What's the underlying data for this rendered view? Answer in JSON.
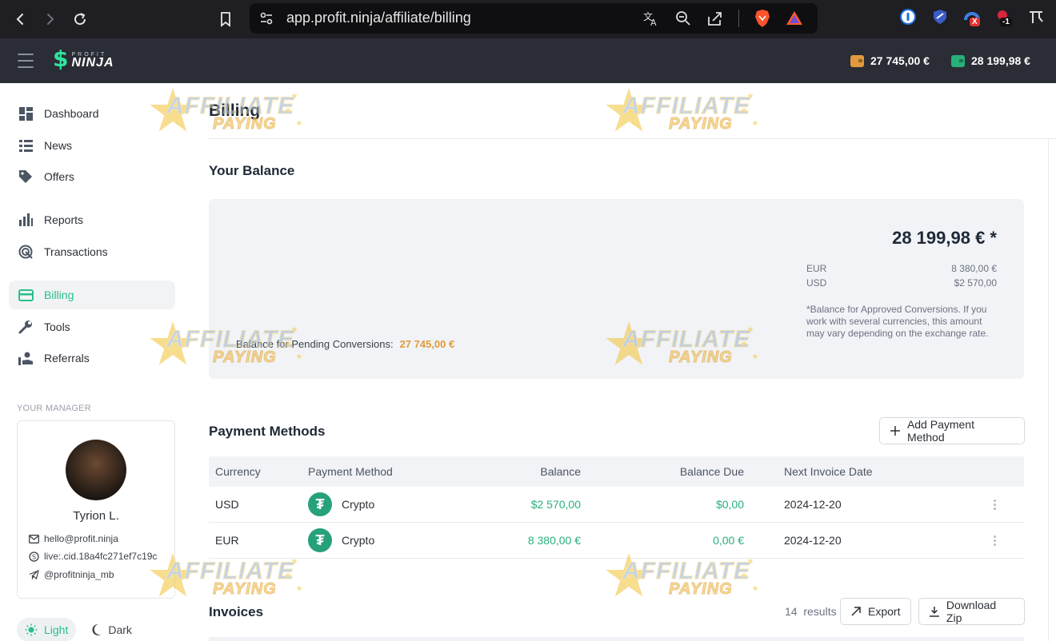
{
  "browser": {
    "url": "app.profit.ninja/affiliate/billing",
    "extension_badges": {
      "x_badge": "X",
      "minus_badge": "-1"
    }
  },
  "header": {
    "logo_small": "PROFIT",
    "logo_big": "NINJA",
    "pending_balance": "27 745,00 €",
    "approved_balance": "28 199,98 €",
    "colors": {
      "pending": "#e29a3c",
      "approved": "#28b07a",
      "bar": "#2a2d35"
    }
  },
  "sidebar": {
    "items": [
      {
        "label": "Dashboard",
        "icon": "dashboard-icon"
      },
      {
        "label": "News",
        "icon": "news-icon"
      },
      {
        "label": "Offers",
        "icon": "tag-icon"
      },
      {
        "label": "Reports",
        "icon": "bar-chart-icon"
      },
      {
        "label": "Transactions",
        "icon": "transactions-icon"
      },
      {
        "label": "Billing",
        "icon": "credit-card-icon",
        "active": true
      },
      {
        "label": "Tools",
        "icon": "wrench-icon"
      },
      {
        "label": "Referrals",
        "icon": "referrals-icon"
      }
    ],
    "manager": {
      "title": "YOUR MANAGER",
      "name": "Tyrion L.",
      "email": "hello@profit.ninja",
      "skype": "live:.cid.18a4fc271ef7c19c",
      "telegram": "@profitninja_mb"
    },
    "theme": {
      "light": "Light",
      "dark": "Dark",
      "active": "light"
    }
  },
  "main": {
    "title": "Billing",
    "balance": {
      "heading": "Your Balance",
      "total": "28 199,98 € *",
      "rows": [
        {
          "currency": "EUR",
          "amount": "8 380,00 €"
        },
        {
          "currency": "USD",
          "amount": "$2 570,00"
        }
      ],
      "note": "*Balance for Approved Conversions. If you work with several currencies, this amount may vary depending on the exchange rate.",
      "pending_label": "Balance for Pending Conversions:",
      "pending_amount": "27 745,00 €"
    },
    "payment_methods": {
      "heading": "Payment Methods",
      "add_button": "Add Payment Method",
      "columns": [
        "Currency",
        "Payment Method",
        "Balance",
        "Balance Due",
        "Next Invoice Date"
      ],
      "rows": [
        {
          "currency": "USD",
          "method": "Crypto",
          "balance": "$2 570,00",
          "due": "$0,00",
          "next_date": "2024-12-20"
        },
        {
          "currency": "EUR",
          "method": "Crypto",
          "balance": "8 380,00 €",
          "due": "0,00 €",
          "next_date": "2024-12-20"
        }
      ]
    },
    "invoices": {
      "heading": "Invoices",
      "count": "14",
      "results_label": "results",
      "export_button": "Export",
      "download_button": "Download Zip"
    }
  },
  "watermark": {
    "line1": "AFFILIATE",
    "line2": "PAYING"
  }
}
